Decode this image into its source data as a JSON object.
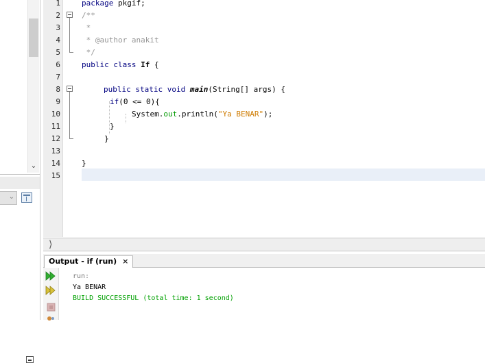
{
  "editor": {
    "line_numbers": [
      "1",
      "2",
      "3",
      "4",
      "5",
      "6",
      "7",
      "8",
      "9",
      "10",
      "11",
      "12",
      "13",
      "14",
      "15"
    ],
    "code": {
      "l1": [
        "package",
        " pkgif;"
      ],
      "l2": "/**",
      "l3": " *",
      "l4": " * @author anakit",
      "l5": " */",
      "l6": [
        "public",
        " ",
        "class",
        " ",
        "If",
        " {"
      ],
      "l8": [
        "public",
        " ",
        "static",
        " ",
        "void",
        " ",
        "main",
        "(String[] args) {"
      ],
      "l9": [
        "if",
        "(0 <= 0){"
      ],
      "l10": [
        "System.",
        "out",
        ".println(",
        "\"Ya BENAR\"",
        ");"
      ],
      "l11": "}",
      "l12": "}",
      "l14": "}"
    }
  },
  "output": {
    "tab_label": "Output - if (run)",
    "close_glyph": "×",
    "lines": {
      "run": "run:",
      "result": "Ya BENAR",
      "build": "BUILD SUCCESSFUL (total time: 1 second)"
    }
  },
  "icons": {
    "left_scroll_down": "chevron-down-icon",
    "minimize": "minimize-icon",
    "nav": "double-chevron-right-icon",
    "rerun": "rerun-icon",
    "rerun_with_options": "rerun-options-icon",
    "stop": "stop-icon",
    "settings": "settings-icon"
  },
  "colors": {
    "keyword": "#000080",
    "comment": "#969696",
    "string": "#ce7b00",
    "field": "#009900",
    "build_success": "#00a000",
    "run_text": "#7a7a7a",
    "current_line": "#e9eff8"
  }
}
